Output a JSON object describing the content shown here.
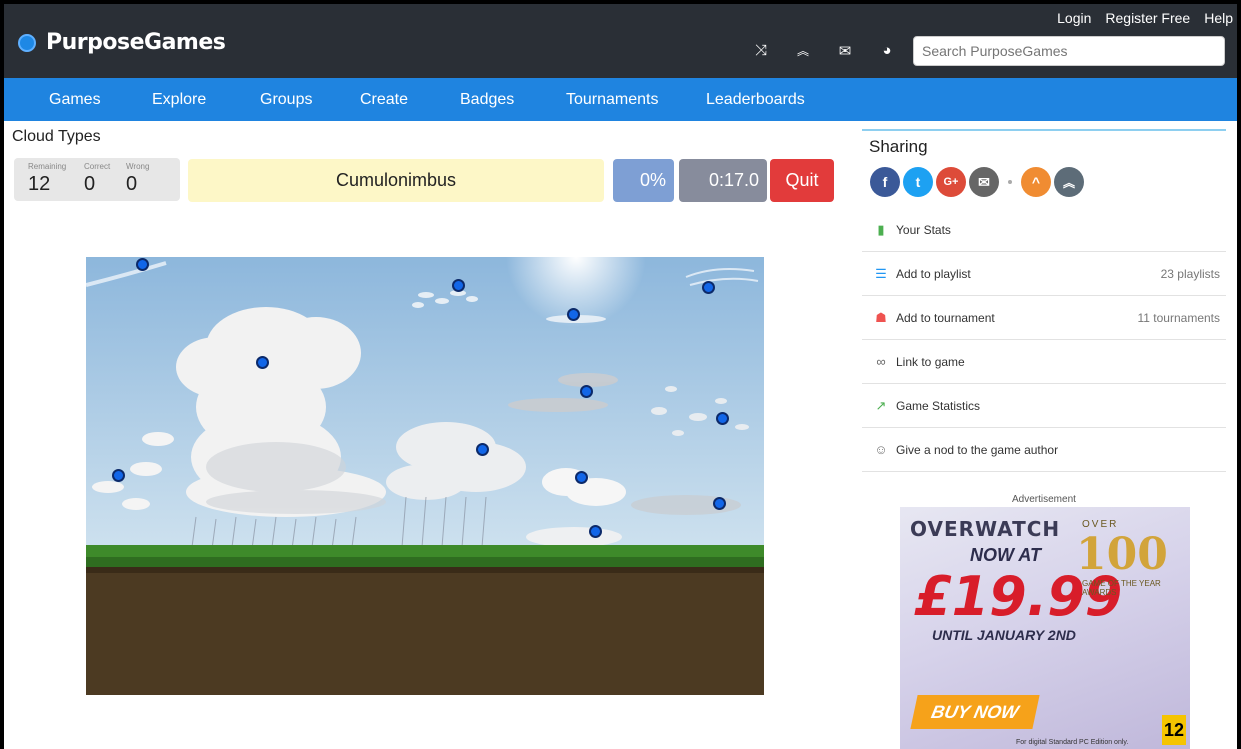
{
  "header": {
    "logo_text": "PurposeGames",
    "links": [
      "Login",
      "Register Free",
      "Help"
    ],
    "icons": [
      "shuffle-icon",
      "chevrons-up-icon",
      "mail-icon",
      "globe-icon"
    ],
    "search_placeholder": "Search PurposeGames"
  },
  "nav": {
    "items": [
      "Games",
      "Explore",
      "Groups",
      "Create",
      "Badges",
      "Tournaments",
      "Leaderboards"
    ]
  },
  "game": {
    "title": "Cloud Types",
    "score": {
      "remaining_label": "Remaining",
      "correct_label": "Correct",
      "wrong_label": "Wrong",
      "remaining": "12",
      "correct": "0",
      "wrong": "0"
    },
    "prompt": "Cumulonimbus",
    "percent": "0%",
    "timer": "0:17.0",
    "quit_label": "Quit"
  },
  "sidebar": {
    "sharing_title": "Sharing",
    "share_icons": [
      "facebook-icon",
      "twitter-icon",
      "google-plus-icon",
      "email-icon",
      "upvote-icon",
      "double-up-icon"
    ],
    "rows": [
      {
        "label": "Your Stats",
        "meta": "",
        "icon": "bar-chart-icon"
      },
      {
        "label": "Add to playlist",
        "meta": "23 playlists",
        "icon": "playlist-icon"
      },
      {
        "label": "Add to tournament",
        "meta": "11 tournaments",
        "icon": "tournament-icon"
      },
      {
        "label": "Link to game",
        "meta": "",
        "icon": "link-icon"
      },
      {
        "label": "Game Statistics",
        "meta": "",
        "icon": "trend-icon"
      },
      {
        "label": "Give a nod to the game author",
        "meta": "",
        "icon": "smile-icon"
      }
    ],
    "ad_label": "Advertisement",
    "ad": {
      "brand": "OVERWATCH",
      "now_at": "NOW AT",
      "price": "£19.99",
      "until": "UNTIL JANUARY 2ND",
      "over": "OVER",
      "awards_count": "100",
      "awards_text": "GAME OF THE YEAR AWARDS",
      "cta": "BUY NOW",
      "fine_print": "For digital Standard PC Edition only.",
      "rating": "12"
    }
  },
  "colors": {
    "topbar": "#2a2f36",
    "nav": "#1f84e0",
    "prompt_bg": "#fdf7c7",
    "quit": "#e23b3b",
    "pin": "#1266e8"
  }
}
